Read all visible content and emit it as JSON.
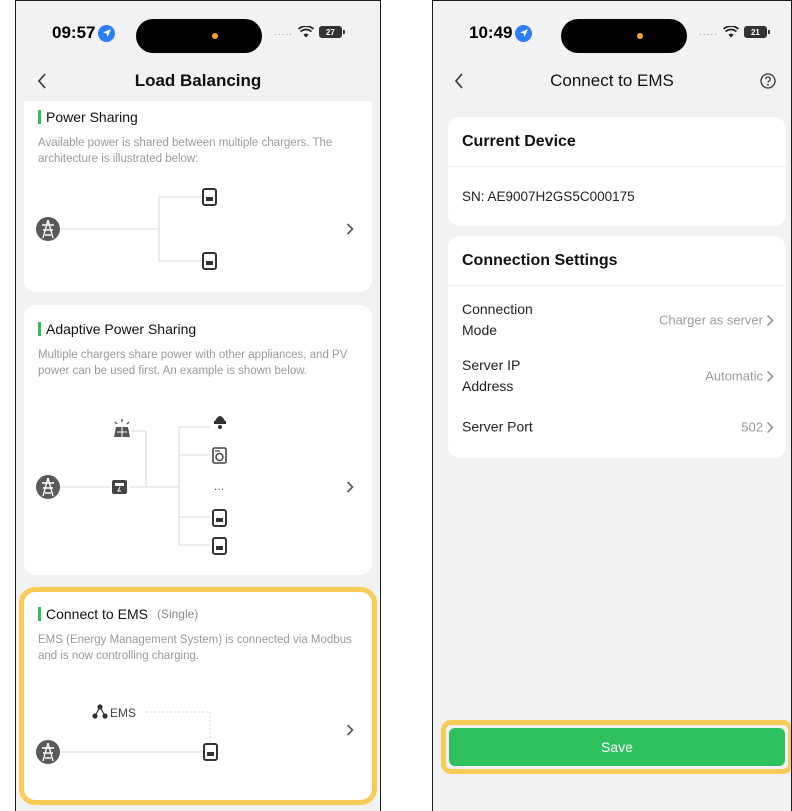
{
  "left_screen": {
    "status": {
      "time": "09:57",
      "signal": ".....",
      "battery": "27"
    },
    "nav": {
      "title": "Load Balancing"
    },
    "cards": [
      {
        "title": "Power Sharing",
        "subtitle": "",
        "description": "Available power is shared between multiple chargers. The architecture is illustrated below:"
      },
      {
        "title": "Adaptive Power Sharing",
        "subtitle": "",
        "description": "Multiple chargers share power with other appliances, and PV power can be used first. An example is shown below.",
        "ellipsis": "…"
      },
      {
        "title": "Connect to EMS",
        "subtitle": "(Single)",
        "description": "EMS (Energy Management System) is connected via Modbus and is now controlling charging.",
        "ems_label": "EMS"
      }
    ]
  },
  "right_screen": {
    "status": {
      "time": "10:49",
      "signal": ".....",
      "battery": "21"
    },
    "nav": {
      "title": "Connect to EMS"
    },
    "current_device": {
      "header": "Current Device",
      "sn": "SN: AE9007H2GS5C000175"
    },
    "connection_settings": {
      "header": "Connection Settings",
      "rows": [
        {
          "label": "Connection\nMode",
          "value": "Charger as server"
        },
        {
          "label": "Server IP\nAddress",
          "value": "Automatic"
        },
        {
          "label": "Server Port",
          "value": "502"
        }
      ]
    },
    "save_label": "Save"
  },
  "colors": {
    "accent_green": "#2ec05c",
    "highlight_yellow": "#f7cd57",
    "screen_bg": "#f2f2f4",
    "location_blue": "#2d7ff9"
  },
  "icons": [
    "back-chevron-icon",
    "help-circle-icon",
    "chevron-right-icon",
    "pylon-icon",
    "charger-icon",
    "solar-panel-icon",
    "inverter-icon",
    "lamp-icon",
    "washing-machine-icon",
    "network-icon",
    "location-icon",
    "wifi-icon",
    "battery-icon"
  ]
}
